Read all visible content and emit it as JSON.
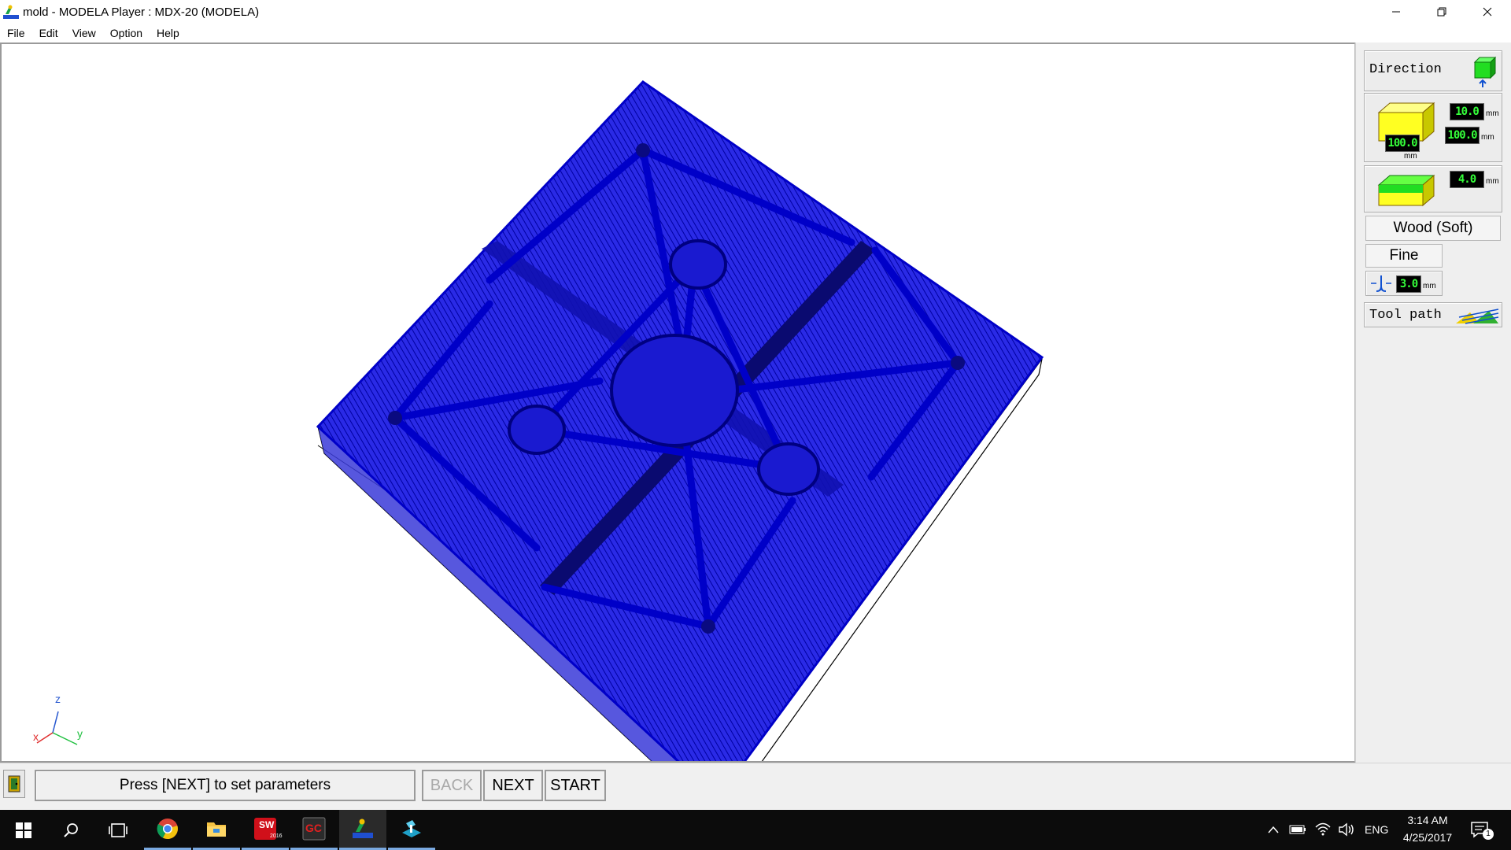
{
  "window": {
    "title": "mold - MODELA Player : MDX-20 (MODELA)"
  },
  "menu": [
    "File",
    "Edit",
    "View",
    "Option",
    "Help"
  ],
  "axes": {
    "x": "x",
    "y": "y",
    "z": "z"
  },
  "panel": {
    "direction_label": "Direction",
    "workpiece": {
      "height": "10.0",
      "depth": "100.0",
      "width": "100.0",
      "unit": "mm"
    },
    "model": {
      "height": "4.0",
      "unit": "mm"
    },
    "material": "Wood (Soft)",
    "quality": "Fine",
    "tool": {
      "diameter": "3.0",
      "unit": "mm"
    },
    "toolpath_label": "Tool path"
  },
  "status": {
    "message": "Press [NEXT] to set parameters",
    "back_label": "BACK",
    "next_label": "NEXT",
    "start_label": "START"
  },
  "taskbar": {
    "language": "ENG",
    "time": "3:14 AM",
    "date": "4/25/2017",
    "notification_count": "1",
    "solidworks_badge": "2016"
  }
}
